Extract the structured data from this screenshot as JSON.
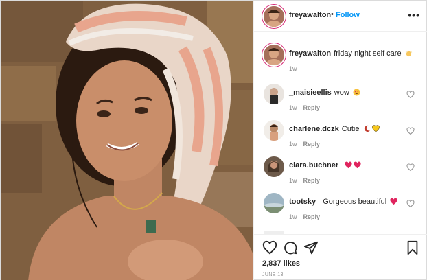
{
  "post": {
    "author": "freyawalton",
    "follow_label": "Follow",
    "dot": "•",
    "more_label": "•••",
    "caption": "friday night self care",
    "caption_time": "1w",
    "likes": "2,837 likes",
    "date": "JUNE 13"
  },
  "comments": [
    {
      "user": "_maisieellis",
      "text": "wow",
      "time": "1w",
      "reply": "Reply",
      "emoji": [
        "heart-eyes-emoji"
      ]
    },
    {
      "user": "charlene.dczk",
      "text": "Cutie",
      "time": "1w",
      "reply": "Reply",
      "emoji": [
        "moon-emoji",
        "yellow-heart-emoji"
      ]
    },
    {
      "user": "clara.buchner",
      "text": "",
      "time": "1w",
      "reply": "Reply",
      "emoji": [
        "red-heart-emoji",
        "red-heart-emoji"
      ]
    },
    {
      "user": "tootsky_",
      "text": "Gorgeous beautiful",
      "time": "1w",
      "reply": "Reply",
      "emoji": [
        "red-heart-emoji"
      ]
    }
  ],
  "colors": {
    "follow": "#0095f6",
    "muted": "#8e8e8e",
    "text": "#262626",
    "border": "#dbdbdb"
  }
}
